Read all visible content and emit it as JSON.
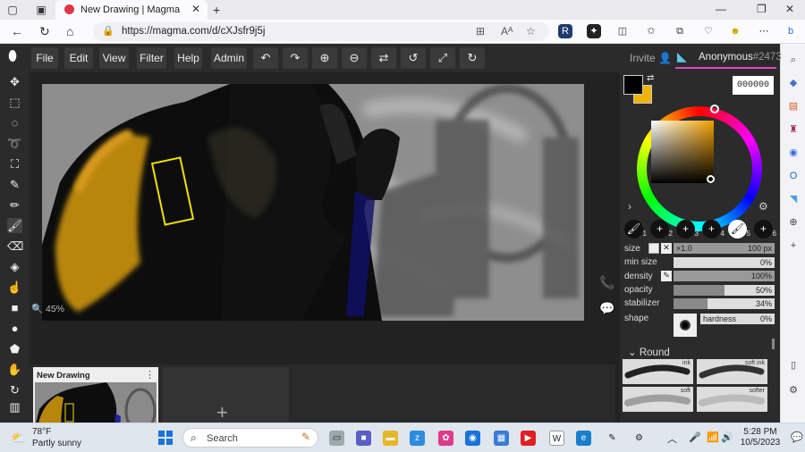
{
  "browser": {
    "tab_title": "New Drawing | Magma",
    "url": "https://magma.com/d/cXJsfr9j5j"
  },
  "menu": {
    "file": "File",
    "edit": "Edit",
    "view": "View",
    "filter": "Filter",
    "help": "Help",
    "admin": "Admin",
    "invite": "Invite",
    "user_name": "Anonymous",
    "user_number": "#2473"
  },
  "canvas": {
    "zoom": "45%"
  },
  "thumbnails": {
    "drawing_title": "New Drawing"
  },
  "color": {
    "hex": "000000",
    "foreground": "#000000",
    "background": "#f0b400"
  },
  "brush_slots": [
    "1",
    "2",
    "3",
    "4",
    "5",
    "6"
  ],
  "props": {
    "size_label": "size",
    "size_mult": "×1.0",
    "size_value": "100 px",
    "minsize_label": "min size",
    "minsize_value": "0%",
    "density_label": "density",
    "density_value": "100%",
    "opacity_label": "opacity",
    "opacity_value": "50%",
    "stabilizer_label": "stabilizer",
    "stabilizer_value": "34%",
    "shape_label": "shape",
    "hardness_label": "hardness",
    "hardness_value": "0%"
  },
  "brush_group": "Round",
  "brush_presets": [
    "ink",
    "soft ink",
    "soft",
    "softer"
  ],
  "taskbar": {
    "weather_temp": "78°F",
    "weather_desc": "Partly sunny",
    "search_placeholder": "Search",
    "time": "5:28 PM",
    "date": "10/5/2023"
  }
}
